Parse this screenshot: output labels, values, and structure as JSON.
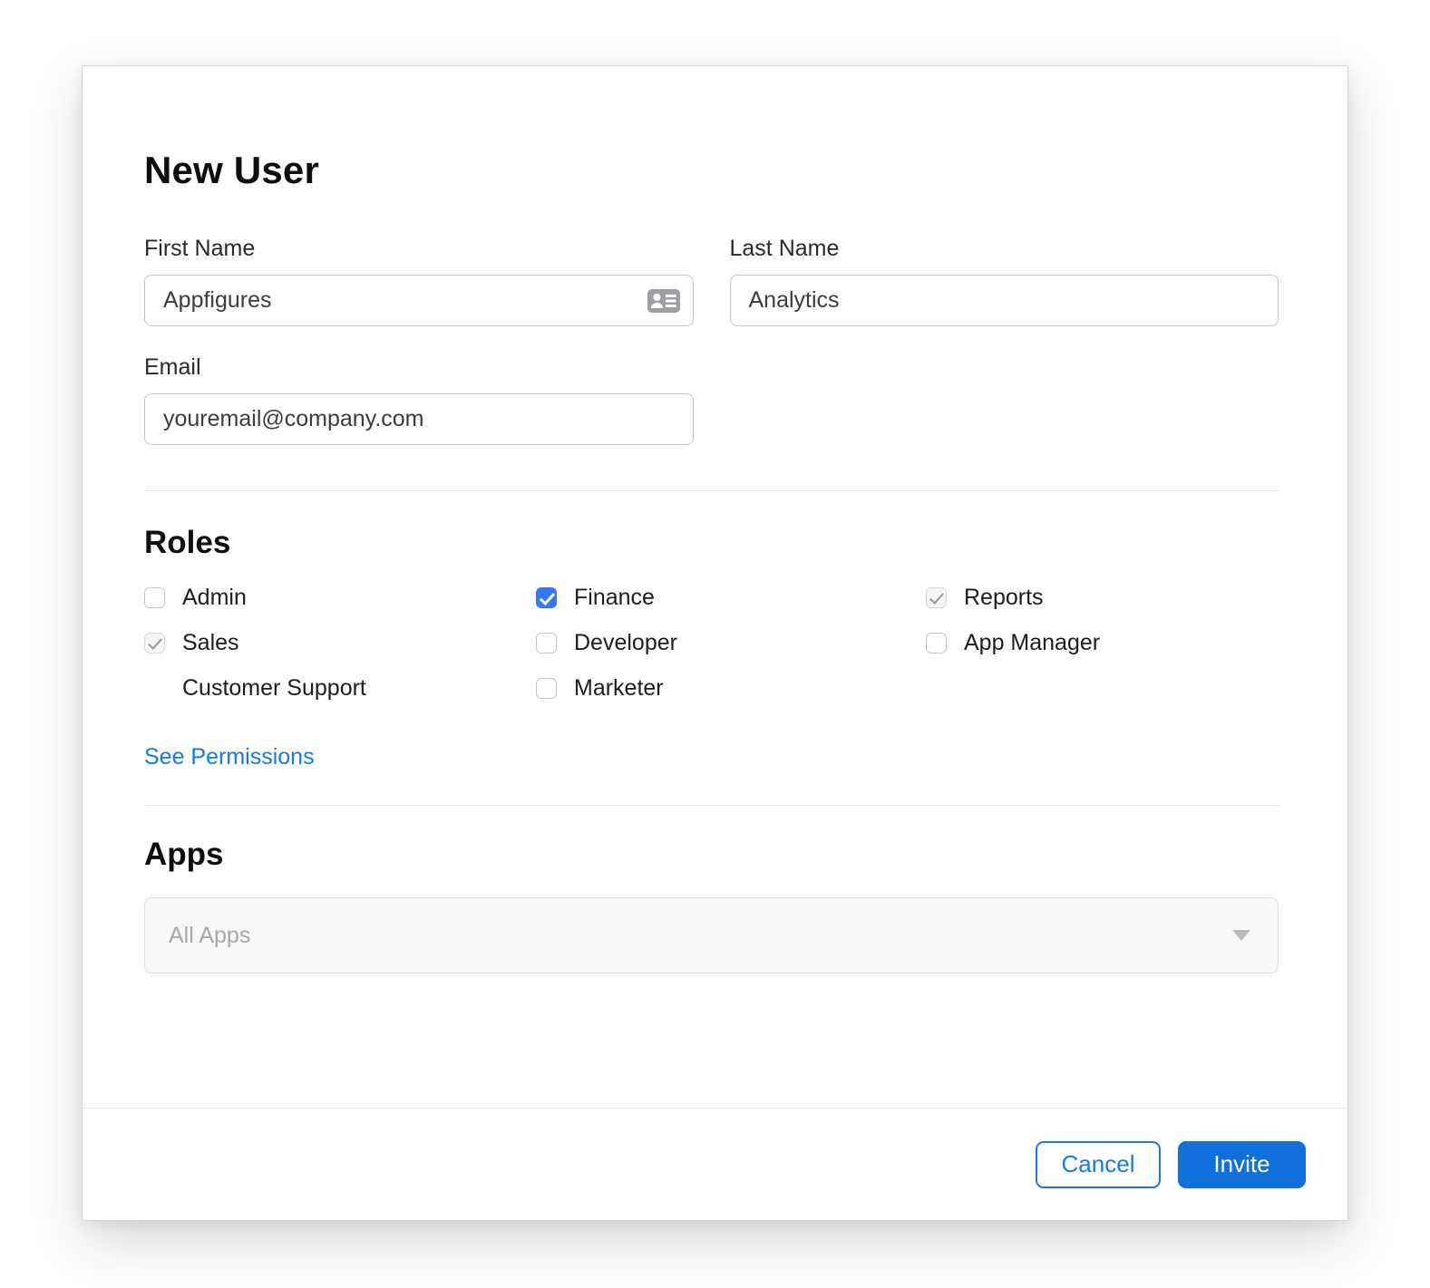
{
  "colors": {
    "accent_link": "#1678F0",
    "invite_button": "#1070DC",
    "checkbox_checked": "#3478F6"
  },
  "dialog": {
    "title": "New User",
    "fields": {
      "first_name": {
        "label": "First Name",
        "value": "Appfigures"
      },
      "last_name": {
        "label": "Last Name",
        "value": "Analytics"
      },
      "email": {
        "label": "Email",
        "value": "youremail@company.com"
      }
    },
    "roles": {
      "heading": "Roles",
      "items": [
        {
          "label": "Admin",
          "state": "unchecked"
        },
        {
          "label": "Finance",
          "state": "checked"
        },
        {
          "label": "Reports",
          "state": "checked-disabled"
        },
        {
          "label": "Sales",
          "state": "checked-disabled"
        },
        {
          "label": "Developer",
          "state": "unchecked"
        },
        {
          "label": "App Manager",
          "state": "unchecked"
        },
        {
          "label": "Customer Support",
          "state": "none"
        },
        {
          "label": "Marketer",
          "state": "unchecked"
        }
      ],
      "see_permissions": "See Permissions"
    },
    "apps": {
      "heading": "Apps",
      "selected": "All Apps"
    },
    "footer": {
      "cancel": "Cancel",
      "invite": "Invite"
    },
    "icons": {
      "first_name_trailing": "contact-card-icon",
      "apps_caret": "chevron-down-icon"
    }
  }
}
